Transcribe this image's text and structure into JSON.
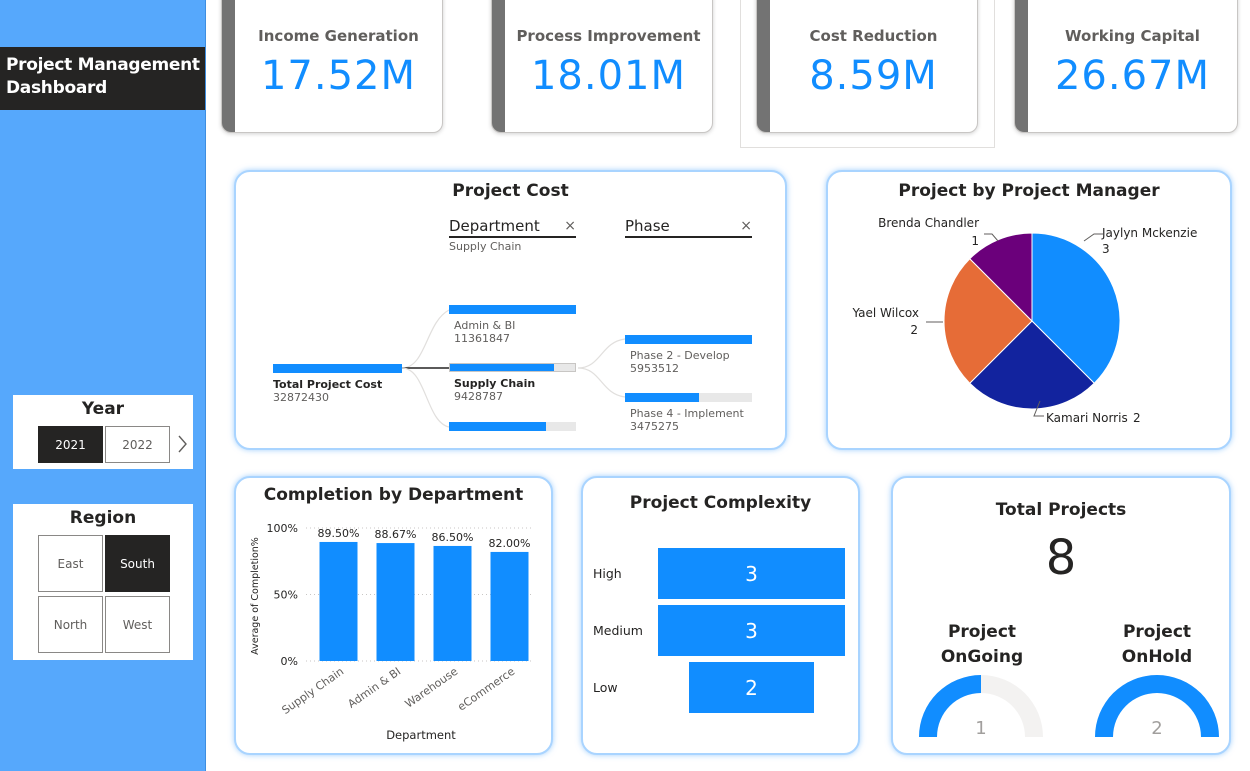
{
  "sidebar": {
    "title_line1": "Project Management",
    "title_line2": "Dashboard",
    "year": {
      "label": "Year",
      "options": [
        "2021",
        "2022"
      ],
      "selected": "2021"
    },
    "region": {
      "label": "Region",
      "options": [
        "East",
        "South",
        "North",
        "West"
      ],
      "selected": "South"
    }
  },
  "kpis": [
    {
      "label": "Income Generation",
      "value": "17.52M"
    },
    {
      "label": "Process Improvement",
      "value": "18.01M"
    },
    {
      "label": "Cost Reduction",
      "value": "8.59M"
    },
    {
      "label": "Working Capital",
      "value": "26.67M"
    }
  ],
  "project_cost": {
    "title": "Project Cost",
    "level1_header": "Department",
    "level1_filter": "Supply Chain",
    "level2_header": "Phase",
    "root": {
      "label": "Total Project Cost",
      "value": "32872430"
    },
    "departments": [
      {
        "label": "Admin & BI",
        "value": "11361847",
        "fraction": 1.0
      },
      {
        "label": "Supply Chain",
        "value": "9428787",
        "fraction": 0.83
      },
      {
        "label": "",
        "value": "",
        "fraction": 0.76
      }
    ],
    "phases": [
      {
        "label": "Phase 2 - Develop",
        "value": "5953512",
        "fraction": 1.0
      },
      {
        "label": "Phase 4 - Implement",
        "value": "3475275",
        "fraction": 0.58
      }
    ]
  },
  "pm_pie": {
    "title": "Project by Project Manager",
    "slices": [
      {
        "name": "Jaylyn Mckenzie",
        "value": 3,
        "color": "#118dff"
      },
      {
        "name": "Kamari Norris",
        "value": 2,
        "color": "#12239e"
      },
      {
        "name": "Yael Wilcox",
        "value": 2,
        "color": "#e66c37"
      },
      {
        "name": "Brenda Chandler",
        "value": 1,
        "color": "#6b007b"
      }
    ]
  },
  "completion": {
    "title": "Completion by Department",
    "xlabel": "Department",
    "ylabel": "Average of Completion%"
  },
  "complexity": {
    "title": "Project Complexity",
    "rows": [
      {
        "label": "High",
        "value": 3
      },
      {
        "label": "Medium",
        "value": 3
      },
      {
        "label": "Low",
        "value": 2
      }
    ]
  },
  "total_projects": {
    "title": "Total Projects",
    "value": "8",
    "ongoing_label_1": "Project",
    "ongoing_label_2": "OnGoing",
    "ongoing_value": 1,
    "onhold_label_1": "Project",
    "onhold_label_2": "OnHold",
    "onhold_value": 2,
    "gauge_max": 2
  },
  "chart_data": {
    "type": "bar",
    "title": "Completion by Department",
    "xlabel": "Department",
    "ylabel": "Average of Completion%",
    "categories": [
      "Supply Chain",
      "Admin & BI",
      "Warehouse",
      "eCommerce"
    ],
    "values": [
      89.5,
      88.67,
      86.5,
      82.0
    ],
    "data_labels": [
      "89.50%",
      "88.67%",
      "86.50%",
      "82.00%"
    ],
    "yticks": [
      "0%",
      "50%",
      "100%"
    ],
    "ylim": [
      0,
      100
    ],
    "color": "#118dff"
  }
}
